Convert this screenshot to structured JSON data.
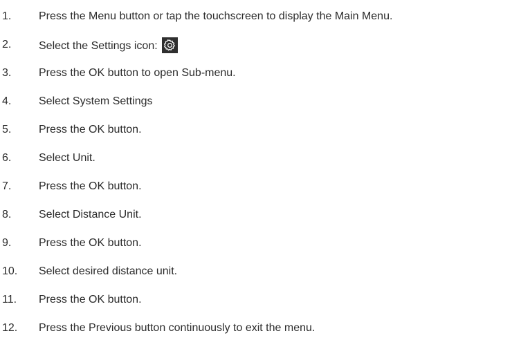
{
  "steps": [
    {
      "num": "1.",
      "text": "Press the Menu button or tap the touchscreen to display the Main Menu."
    },
    {
      "num": "2.",
      "text": "Select the Settings icon:",
      "icon": "settings-gear-icon"
    },
    {
      "num": "3.",
      "text": "Press the OK button to open Sub-menu."
    },
    {
      "num": "4.",
      "text": "Select System Settings"
    },
    {
      "num": "5.",
      "text": "Press the OK button."
    },
    {
      "num": "6.",
      "text": "Select Unit."
    },
    {
      "num": "7.",
      "text": "Press the OK button."
    },
    {
      "num": "8.",
      "text": "Select Distance Unit."
    },
    {
      "num": "9.",
      "text": "Press the OK button."
    },
    {
      "num": "10.",
      "text": "Select desired distance unit."
    },
    {
      "num": "11.",
      "text": "Press the OK button."
    },
    {
      "num": "12.",
      "text": "Press the Previous button continuously to exit the menu."
    }
  ]
}
